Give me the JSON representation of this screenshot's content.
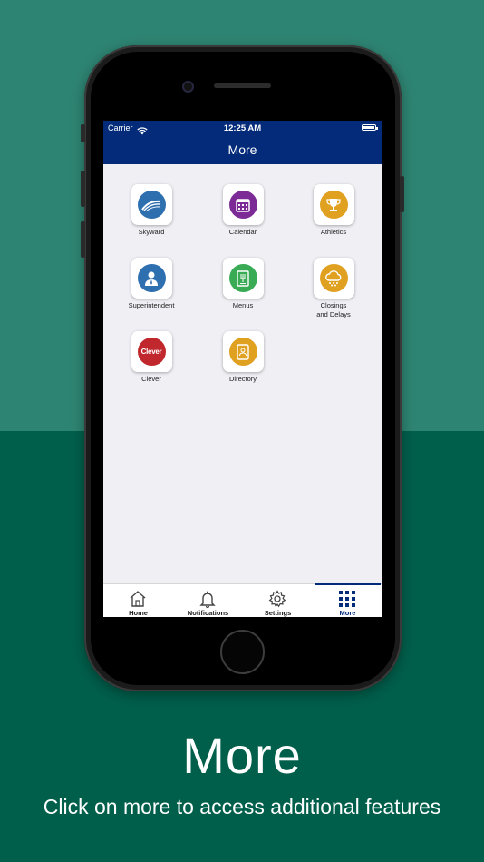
{
  "status_bar": {
    "carrier": "Carrier",
    "time": "12:25 AM"
  },
  "nav": {
    "title": "More"
  },
  "tiles": [
    {
      "label": "Skyward",
      "icon": "skyward-icon",
      "color": "#2e6fb0"
    },
    {
      "label": "Calendar",
      "icon": "calendar-icon",
      "color": "#7b2a96"
    },
    {
      "label": "Athletics",
      "icon": "trophy-icon",
      "color": "#e0a020"
    },
    {
      "label": "Superintendent",
      "icon": "person-icon",
      "color": "#2e6fb0"
    },
    {
      "label": "Menus",
      "icon": "menu-icon",
      "color": "#3aab55"
    },
    {
      "label": "Closings\nand Delays",
      "icon": "weather-icon",
      "color": "#e0a020"
    },
    {
      "label": "Clever",
      "icon": "clever-logo-icon",
      "color": "#c0282d",
      "logo_text": "Clever"
    },
    {
      "label": "Directory",
      "icon": "directory-icon",
      "color": "#e0a020"
    }
  ],
  "tabbar": [
    {
      "label": "Home",
      "icon": "home-icon"
    },
    {
      "label": "Notifications",
      "icon": "bell-icon"
    },
    {
      "label": "Settings",
      "icon": "gear-icon"
    },
    {
      "label": "More",
      "icon": "grid-icon",
      "active": true
    }
  ],
  "caption": {
    "title": "More",
    "subtitle": "Click on more to access additional features"
  },
  "colors": {
    "nav": "#032b7a",
    "bg_top": "#2e8472",
    "bg_bottom": "#005f4b"
  }
}
